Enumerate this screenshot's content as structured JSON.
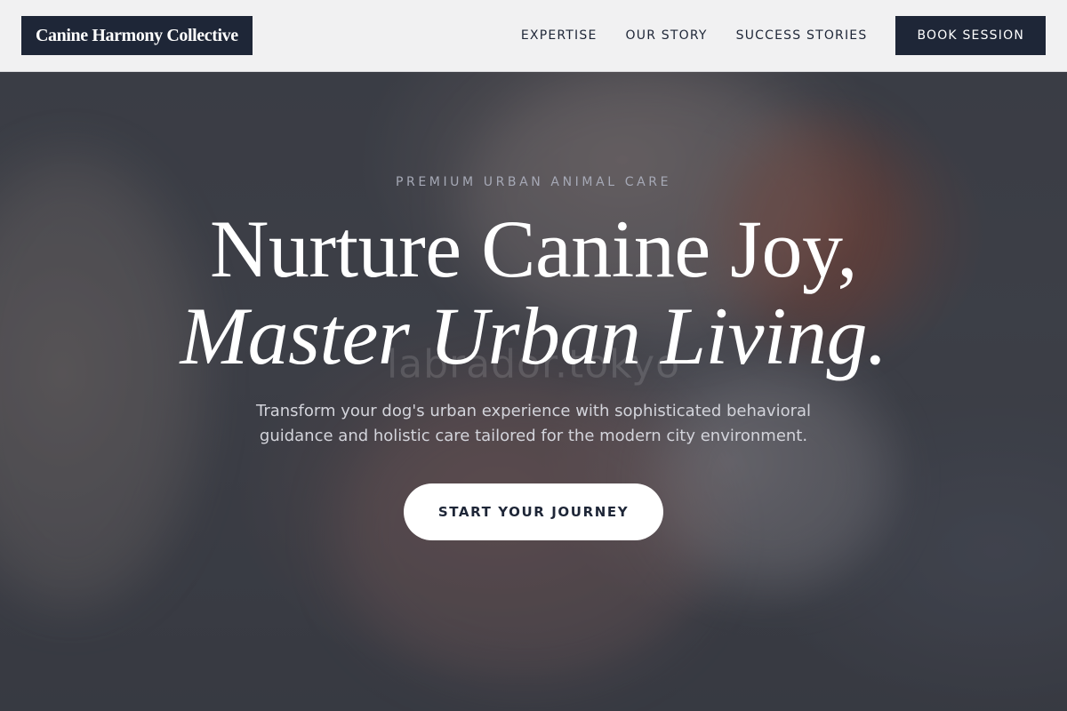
{
  "header": {
    "logo_text": "Canine Harmony Collective",
    "nav": [
      {
        "label": "EXPERTISE"
      },
      {
        "label": "OUR STORY"
      },
      {
        "label": "SUCCESS STORIES"
      }
    ],
    "book_label": "BOOK SESSION"
  },
  "hero": {
    "watermark": "labrador.tokyo",
    "eyebrow": "PREMIUM URBAN ANIMAL CARE",
    "headline_line1": "Nurture Canine Joy,",
    "headline_line2": "Master Urban Living.",
    "subtitle": "Transform your dog's urban experience with sophisticated behavioral guidance and holistic care tailored for the modern city environment.",
    "cta_label": "START YOUR JOURNEY"
  },
  "colors": {
    "brand_navy": "#1e2637",
    "header_bg": "#f1f1f2",
    "eyebrow": "#a6a9b6",
    "subtitle": "#d3d4db",
    "cta_bg": "#ffffff"
  }
}
